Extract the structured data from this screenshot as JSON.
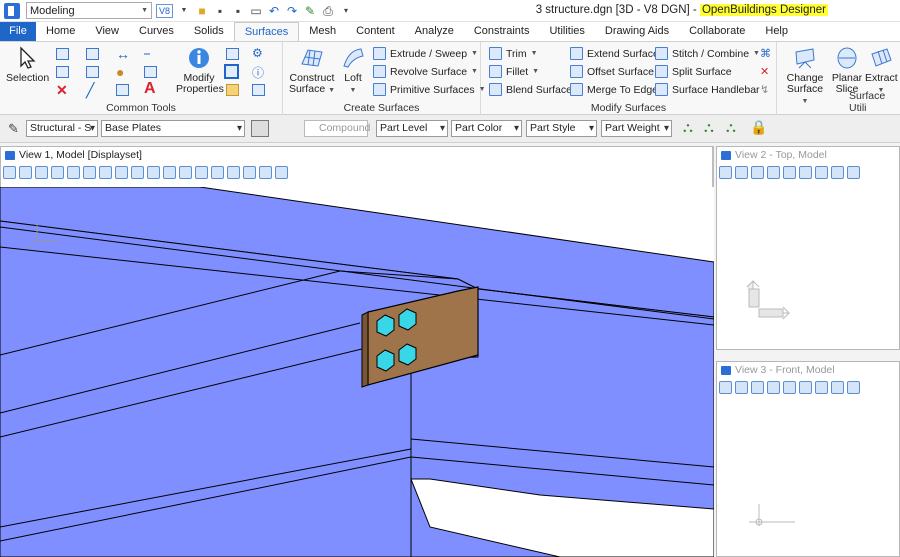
{
  "titlebar": {
    "workflow": "Modeling",
    "version_badge": "V8",
    "title_main": "3 structure.dgn [3D - V8 DGN] - ",
    "title_app": "OpenBuildings Designer"
  },
  "tabs": [
    "File",
    "Home",
    "View",
    "Curves",
    "Solids",
    "Surfaces",
    "Mesh",
    "Content",
    "Analyze",
    "Constraints",
    "Utilities",
    "Drawing Aids",
    "Collaborate",
    "Help"
  ],
  "ribbon": {
    "common_tools": {
      "label": "Common Tools",
      "selection": "Selection",
      "modify_properties_1": "Modify",
      "modify_properties_2": "Properties"
    },
    "create_surfaces": {
      "label": "Create Surfaces",
      "construct_1": "Construct",
      "construct_2": "Surface",
      "loft": "Loft",
      "extrude": "Extrude / Sweep",
      "revolve": "Revolve Surface",
      "primitive": "Primitive Surfaces"
    },
    "modify_surfaces": {
      "label": "Modify Surfaces",
      "trim": "Trim",
      "fillet": "Fillet",
      "blend": "Blend Surfaces",
      "extend": "Extend Surface",
      "offset": "Offset Surface",
      "merge": "Merge To Edge",
      "stitch": "Stitch / Combine",
      "split": "Split Surface",
      "handlebar": "Surface Handlebar"
    },
    "surface_utilities": {
      "label": "Surface Utili",
      "change_1": "Change",
      "change_2": "Surface",
      "planar_1": "Planar",
      "planar_2": "Slice",
      "extract": "Extract"
    }
  },
  "attributes": {
    "family": "Structural - S",
    "part": "Base Plates",
    "compound": "Compound",
    "level": "Part Level",
    "color": "Part Color",
    "style": "Part Style",
    "weight": "Part Weight"
  },
  "views": {
    "v1": "View 1, Model [Displayset]",
    "v2": "View 2 - Top, Model",
    "v3": "View 3 - Front, Model"
  }
}
